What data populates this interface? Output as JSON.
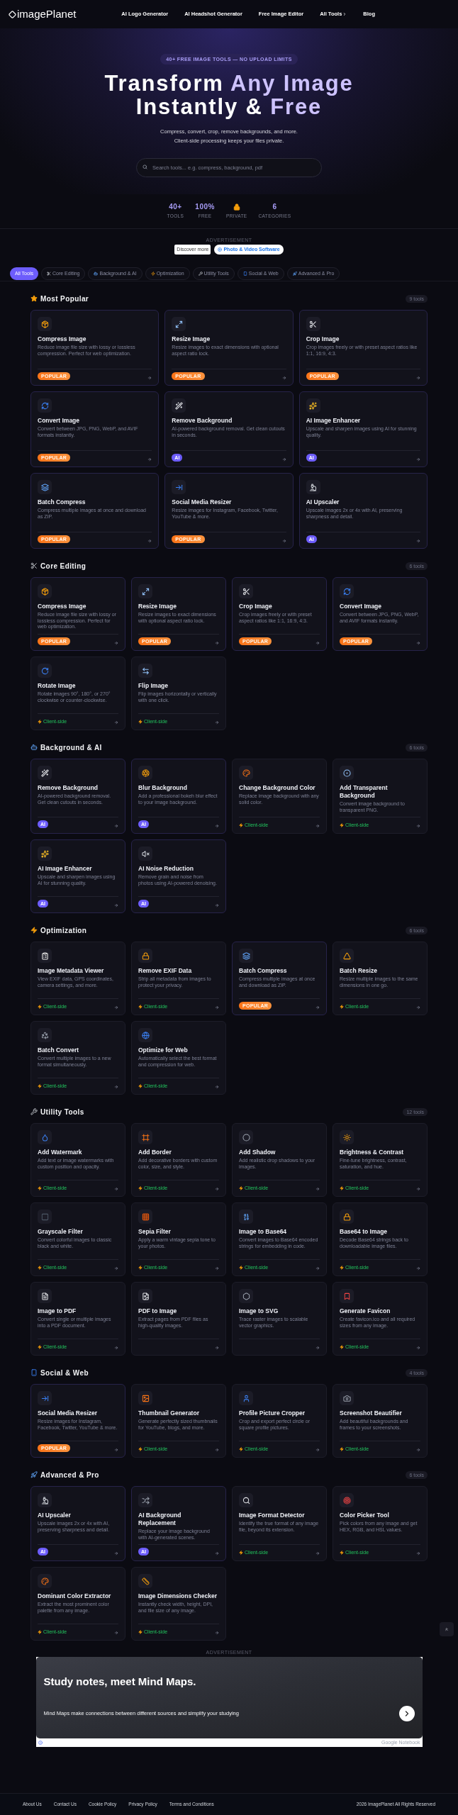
{
  "header": {
    "logo": "imagePlanet",
    "nav": [
      {
        "label": "AI Logo Generator",
        "kind": "link"
      },
      {
        "label": "AI Headshot Generator",
        "kind": "link"
      },
      {
        "label": "Free Image Editor",
        "kind": "link"
      },
      {
        "label": "All Tools",
        "kind": "menu"
      },
      {
        "label": "Blog",
        "kind": "link"
      }
    ]
  },
  "hero": {
    "badge": "40+ FREE IMAGE TOOLS — NO UPLOAD LIMITS",
    "title_lines": [
      [
        {
          "text": "Transform",
          "accent": false
        },
        {
          "text": "Any Image",
          "accent": true
        }
      ],
      [
        {
          "text": "Instantly &",
          "accent": false
        },
        {
          "text": "Free",
          "accent": true
        }
      ]
    ],
    "subtitle_lines": [
      "Compress, convert, crop, remove backgrounds, and more.",
      "Client-side processing keeps your files private."
    ],
    "search": {
      "placeholder": "Search tools... e.g. compress, background, pdf"
    }
  },
  "stats": [
    {
      "kind": "number",
      "value": "40+",
      "label": "TOOLS"
    },
    {
      "kind": "number",
      "value": "100%",
      "label": "FREE"
    },
    {
      "kind": "lock",
      "label": "PRIVATE"
    },
    {
      "kind": "number",
      "value": "6",
      "label": "CATEGORIES"
    }
  ],
  "top_ad": {
    "label": "ADVERTISEMENT",
    "buttons": [
      {
        "kind": "plain",
        "label": "Discover more"
      },
      {
        "kind": "play",
        "label": "Photo & Video Software"
      }
    ]
  },
  "tabs": [
    {
      "label": "All Tools",
      "selected": true
    },
    {
      "label": "Core Editing",
      "selected": false
    },
    {
      "label": "Background & AI",
      "selected": false
    },
    {
      "label": "Optimization",
      "selected": false
    },
    {
      "label": "Utility Tools",
      "selected": false
    },
    {
      "label": "Social & Web",
      "selected": false
    },
    {
      "label": "Advanced & Pro",
      "selected": false
    }
  ],
  "sections": [
    {
      "kind": "featured",
      "title": "Most Popular",
      "count": "9 tools",
      "tools": [
        {
          "title": "Compress Image",
          "description": "Reduce image file size with lossy or lossless compression. Perfect for web optimization.",
          "badge": {
            "kind": "popular",
            "label": "POPULAR"
          }
        },
        {
          "title": "Resize Image",
          "description": "Resize images to exact dimensions with optional aspect ratio lock.",
          "badge": {
            "kind": "popular",
            "label": "POPULAR"
          }
        },
        {
          "title": "Crop Image",
          "description": "Crop images freely or with preset aspect ratios like 1:1, 16:9, 4:3.",
          "badge": {
            "kind": "popular",
            "label": "POPULAR"
          }
        },
        {
          "title": "Convert Image",
          "description": "Convert between JPG, PNG, WebP, and AVIF formats instantly.",
          "badge": {
            "kind": "popular",
            "label": "POPULAR"
          }
        },
        {
          "title": "Remove Background",
          "description": "AI-powered background removal. Get clean cutouts in seconds.",
          "badge": {
            "kind": "ai",
            "label": "AI"
          }
        },
        {
          "title": "AI Image Enhancer",
          "description": "Upscale and sharpen images using AI for stunning quality.",
          "badge": {
            "kind": "ai",
            "label": "AI"
          }
        },
        {
          "title": "Batch Compress",
          "description": "Compress multiple images at once and download as ZIP.",
          "badge": {
            "kind": "popular",
            "label": "POPULAR"
          }
        },
        {
          "title": "Social Media Resizer",
          "description": "Resize images for Instagram, Facebook, Twitter, YouTube & more.",
          "badge": {
            "kind": "popular",
            "label": "POPULAR"
          }
        },
        {
          "title": "AI Upscaler",
          "description": "Upscale images 2x or 4x with AI, preserving sharpness and detail.",
          "badge": {
            "kind": "ai",
            "label": "AI"
          }
        }
      ]
    },
    {
      "kind": "category",
      "title": "Core Editing",
      "count": "6 tools",
      "tools": [
        {
          "title": "Compress Image",
          "description": "Reduce image file size with lossy or lossless compression. Perfect for web optimization.",
          "badge": {
            "kind": "popular",
            "label": "POPULAR"
          }
        },
        {
          "title": "Resize Image",
          "description": "Resize images to exact dimensions with optional aspect ratio lock.",
          "badge": {
            "kind": "popular",
            "label": "POPULAR"
          }
        },
        {
          "title": "Crop Image",
          "description": "Crop images freely or with preset aspect ratios like 1:1, 16:9, 4:3.",
          "badge": {
            "kind": "popular",
            "label": "POPULAR"
          }
        },
        {
          "title": "Convert Image",
          "description": "Convert between JPG, PNG, WebP, and AVIF formats instantly.",
          "badge": {
            "kind": "popular",
            "label": "POPULAR"
          }
        },
        {
          "title": "Rotate Image",
          "description": "Rotate images 90°, 180°, or 270° clockwise or counter-clockwise.",
          "badge": {
            "kind": "client",
            "label": "Client-side"
          }
        },
        {
          "title": "Flip Image",
          "description": "Flip images horizontally or vertically with one click.",
          "badge": {
            "kind": "client",
            "label": "Client-side"
          }
        }
      ]
    },
    {
      "kind": "category",
      "title": "Background & AI",
      "count": "6 tools",
      "tools": [
        {
          "title": "Remove Background",
          "description": "AI-powered background removal. Get clean cutouts in seconds.",
          "badge": {
            "kind": "ai",
            "label": "AI"
          }
        },
        {
          "title": "Blur Background",
          "description": "Add a professional bokeh blur effect to your image background.",
          "badge": {
            "kind": "ai",
            "label": "AI"
          }
        },
        {
          "title": "Change Background Color",
          "description": "Replace image background with any solid color.",
          "badge": {
            "kind": "client",
            "label": "Client-side"
          }
        },
        {
          "title": "Add Transparent Background",
          "description": "Convert image background to transparent PNG.",
          "badge": {
            "kind": "client",
            "label": "Client-side"
          }
        },
        {
          "title": "AI Image Enhancer",
          "description": "Upscale and sharpen images using AI for stunning quality.",
          "badge": {
            "kind": "ai",
            "label": "AI"
          }
        },
        {
          "title": "AI Noise Reduction",
          "description": "Remove grain and noise from photos using AI-powered denoising.",
          "badge": {
            "kind": "ai",
            "label": "AI"
          }
        }
      ]
    },
    {
      "kind": "category",
      "title": "Optimization",
      "count": "6 tools",
      "tools": [
        {
          "title": "Image Metadata Viewer",
          "description": "View EXIF data, GPS coordinates, camera settings, and more.",
          "badge": {
            "kind": "client",
            "label": "Client-side"
          }
        },
        {
          "title": "Remove EXIF Data",
          "description": "Strip all metadata from images to protect your privacy.",
          "badge": {
            "kind": "client",
            "label": "Client-side"
          }
        },
        {
          "title": "Batch Compress",
          "description": "Compress multiple images at once and download as ZIP.",
          "badge": {
            "kind": "popular",
            "label": "POPULAR"
          }
        },
        {
          "title": "Batch Resize",
          "description": "Resize multiple images to the same dimensions in one go.",
          "badge": {
            "kind": "client",
            "label": "Client-side"
          }
        },
        {
          "title": "Batch Convert",
          "description": "Convert multiple images to a new format simultaneously.",
          "badge": {
            "kind": "client",
            "label": "Client-side"
          }
        },
        {
          "title": "Optimize for Web",
          "description": "Automatically select the best format and compression for web.",
          "badge": {
            "kind": "client",
            "label": "Client-side"
          }
        }
      ]
    },
    {
      "kind": "category",
      "title": "Utility Tools",
      "count": "12 tools",
      "tools": [
        {
          "title": "Add Watermark",
          "description": "Add text or image watermarks with custom position and opacity.",
          "badge": {
            "kind": "client",
            "label": "Client-side"
          }
        },
        {
          "title": "Add Border",
          "description": "Add decorative borders with custom color, size, and style.",
          "badge": {
            "kind": "client",
            "label": "Client-side"
          }
        },
        {
          "title": "Add Shadow",
          "description": "Add realistic drop shadows to your images.",
          "badge": {
            "kind": "client",
            "label": "Client-side"
          }
        },
        {
          "title": "Brightness & Contrast",
          "description": "Fine-tune brightness, contrast, saturation, and hue.",
          "badge": {
            "kind": "client",
            "label": "Client-side"
          }
        },
        {
          "title": "Grayscale Filter",
          "description": "Convert colorful images to classic black and white.",
          "badge": {
            "kind": "client",
            "label": "Client-side"
          }
        },
        {
          "title": "Sepia Filter",
          "description": "Apply a warm vintage sepia tone to your photos.",
          "badge": {
            "kind": "client",
            "label": "Client-side"
          }
        },
        {
          "title": "Image to Base64",
          "description": "Convert images to Base64 encoded strings for embedding in code.",
          "badge": {
            "kind": "client",
            "label": "Client-side"
          }
        },
        {
          "title": "Base64 to Image",
          "description": "Decode Base64 strings back to downloadable image files.",
          "badge": {
            "kind": "client",
            "label": "Client-side"
          }
        },
        {
          "title": "Image to PDF",
          "description": "Convert single or multiple images into a PDF document.",
          "badge": {
            "kind": "client",
            "label": "Client-side"
          }
        },
        {
          "title": "PDF to Image",
          "description": "Extract pages from PDF files as high-quality images."
        },
        {
          "title": "Image to SVG",
          "description": "Trace raster images to scalable vector graphics."
        },
        {
          "title": "Generate Favicon",
          "description": "Create favicon.ico and all required sizes from any image.",
          "badge": {
            "kind": "client",
            "label": "Client-side"
          }
        }
      ]
    },
    {
      "kind": "category",
      "title": "Social & Web",
      "count": "4 tools",
      "tools": [
        {
          "title": "Social Media Resizer",
          "description": "Resize images for Instagram, Facebook, Twitter, YouTube & more.",
          "badge": {
            "kind": "popular",
            "label": "POPULAR"
          }
        },
        {
          "title": "Thumbnail Generator",
          "description": "Generate perfectly sized thumbnails for YouTube, blogs, and more.",
          "badge": {
            "kind": "client",
            "label": "Client-side"
          }
        },
        {
          "title": "Profile Picture Cropper",
          "description": "Crop and export perfect circle or square profile pictures.",
          "badge": {
            "kind": "client",
            "label": "Client-side"
          }
        },
        {
          "title": "Screenshot Beautifier",
          "description": "Add beautiful backgrounds and frames to your screenshots.",
          "badge": {
            "kind": "client",
            "label": "Client-side"
          }
        }
      ]
    },
    {
      "kind": "category",
      "title": "Advanced & Pro",
      "count": "6 tools",
      "tools": [
        {
          "title": "AI Upscaler",
          "description": "Upscale images 2x or 4x with AI, preserving sharpness and detail.",
          "badge": {
            "kind": "ai",
            "label": "AI"
          }
        },
        {
          "title": "AI Background Replacement",
          "description": "Replace your image background with AI-generated scenes.",
          "badge": {
            "kind": "ai",
            "label": "AI"
          }
        },
        {
          "title": "Image Format Detector",
          "description": "Identify the true format of any image file, beyond its extension.",
          "badge": {
            "kind": "client",
            "label": "Client-side"
          }
        },
        {
          "title": "Color Picker Tool",
          "description": "Pick colors from any image and get HEX, RGB, and HSL values.",
          "badge": {
            "kind": "client",
            "label": "Client-side"
          }
        },
        {
          "title": "Dominant Color Extractor",
          "description": "Extract the most prominent color palette from any image.",
          "badge": {
            "kind": "client",
            "label": "Client-side"
          }
        },
        {
          "title": "Image Dimensions Checker",
          "description": "Instantly check width, height, DPI, and file size of any image.",
          "badge": {
            "kind": "client",
            "label": "Client-side"
          }
        }
      ]
    }
  ],
  "bottom_ad": {
    "label": "ADVERTISEMENT",
    "headline": "Study notes, meet Mind Maps.",
    "body": "Mind Maps make connections between different sources and simplify your studying",
    "advertiser": "Google Notebook"
  },
  "footer": {
    "links": [
      "About Us",
      "Contact Us",
      "Cookie Policy",
      "Privacy Policy",
      "Terms and Conditions"
    ],
    "copyright": "2026 ImagePlanet All Rights Reserved"
  }
}
